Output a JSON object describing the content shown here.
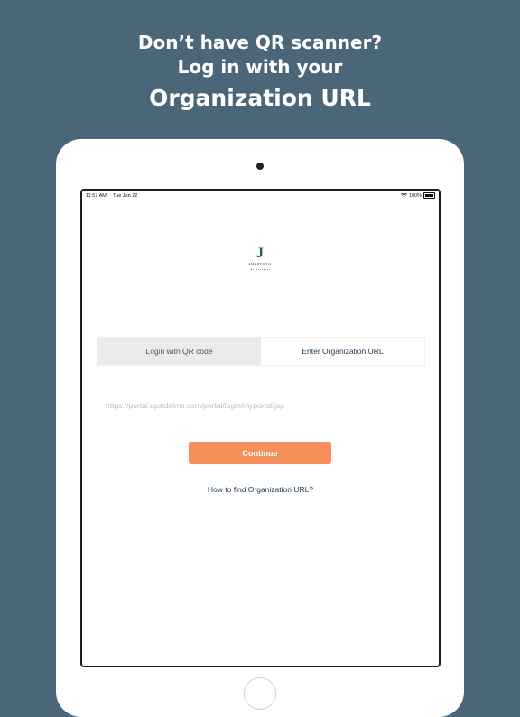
{
  "headline": {
    "line1": "Don’t have QR scanner?",
    "line2": "Log in with your",
    "line3": "Organization URL"
  },
  "statusbar": {
    "time": "11:57 AM",
    "date": "Tue Jun 22",
    "battery": "100%"
  },
  "logo": {
    "mark": "J",
    "word": "SMARTICUS"
  },
  "tabs": {
    "qr_label": "Login with QR code",
    "url_label": "Enter Organization URL",
    "active": "url"
  },
  "form": {
    "url_placeholder": "https://portal.upsidelms.com/portal/login/myportal.jsp",
    "url_value": "",
    "continue_label": "Continue",
    "help_link": "How to find Organization URL?"
  },
  "colors": {
    "background": "#4a6678",
    "accent_button": "#f7905a",
    "link_text": "#1b3a57",
    "logo_green": "#1f6b3b"
  }
}
